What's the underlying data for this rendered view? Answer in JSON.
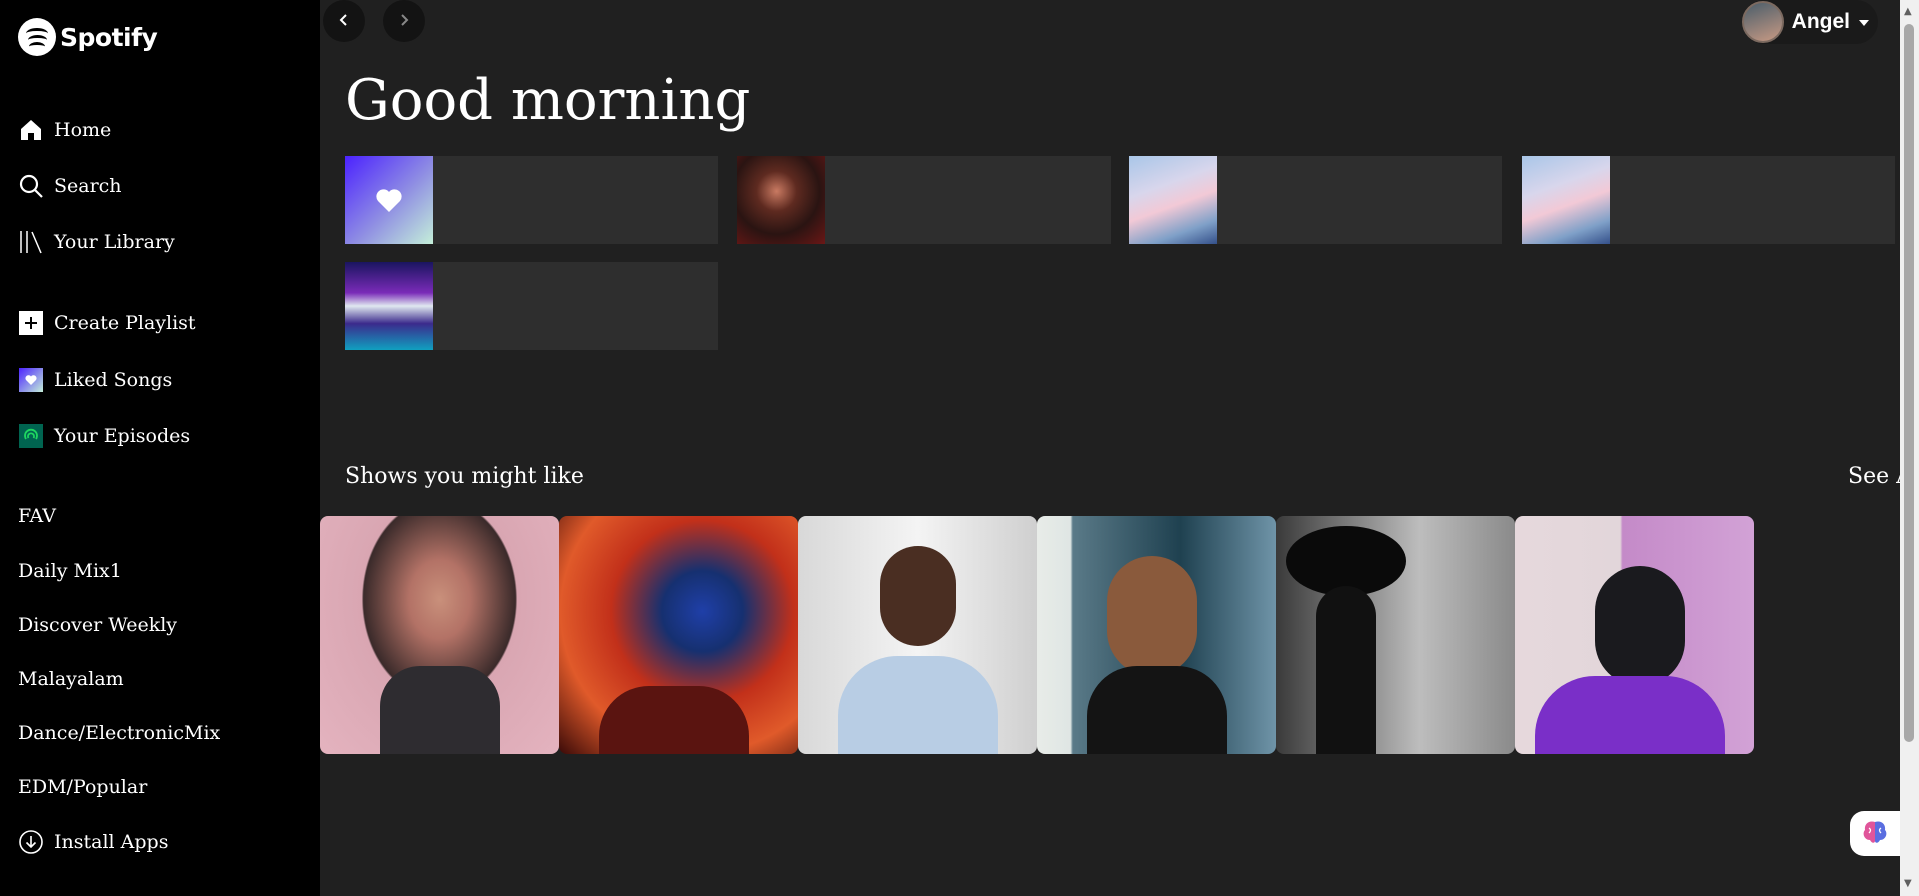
{
  "app": {
    "name": "Spotify"
  },
  "sidebar": {
    "nav": [
      {
        "label": "Home",
        "icon": "home-icon"
      },
      {
        "label": "Search",
        "icon": "search-icon"
      },
      {
        "label": "Your Library",
        "icon": "library-icon"
      }
    ],
    "actions": [
      {
        "label": "Create Playlist",
        "icon": "plus-icon"
      },
      {
        "label": "Liked Songs",
        "icon": "heart-icon"
      },
      {
        "label": "Your Episodes",
        "icon": "podcast-icon"
      }
    ],
    "playlists": [
      "FAV",
      "Daily Mix1",
      "Discover Weekly",
      "Malayalam",
      "Dance/ElectronicMix",
      "EDM/Popular"
    ],
    "install": {
      "label": "Install Apps",
      "icon": "download-icon"
    }
  },
  "header": {
    "user_name": "Angel"
  },
  "main": {
    "greeting": "Good morning",
    "shortcut_tiles": [
      {
        "art": "liked-songs-art"
      },
      {
        "art": "artist-art"
      },
      {
        "art": "kda-group-art"
      },
      {
        "art": "kda-group-art"
      },
      {
        "art": "marshmello-art"
      }
    ],
    "shows_section": {
      "title": "Shows you might like",
      "see_all": "See All",
      "cards": [
        {
          "art": "bearded-man-photo"
        },
        {
          "art": "blue-hair-woman-photo"
        },
        {
          "art": "smiling-man-photo"
        },
        {
          "art": "beach-woman-photo"
        },
        {
          "art": "hat-woman-photo"
        },
        {
          "art": "sunglasses-woman-photo"
        }
      ]
    }
  },
  "colors": {
    "sidebar_bg": "#000000",
    "main_bg": "#202020",
    "tile_bg": "#2e2e2e",
    "liked_gradient_start": "#4b22ff",
    "liked_gradient_end": "#c4efd9"
  }
}
